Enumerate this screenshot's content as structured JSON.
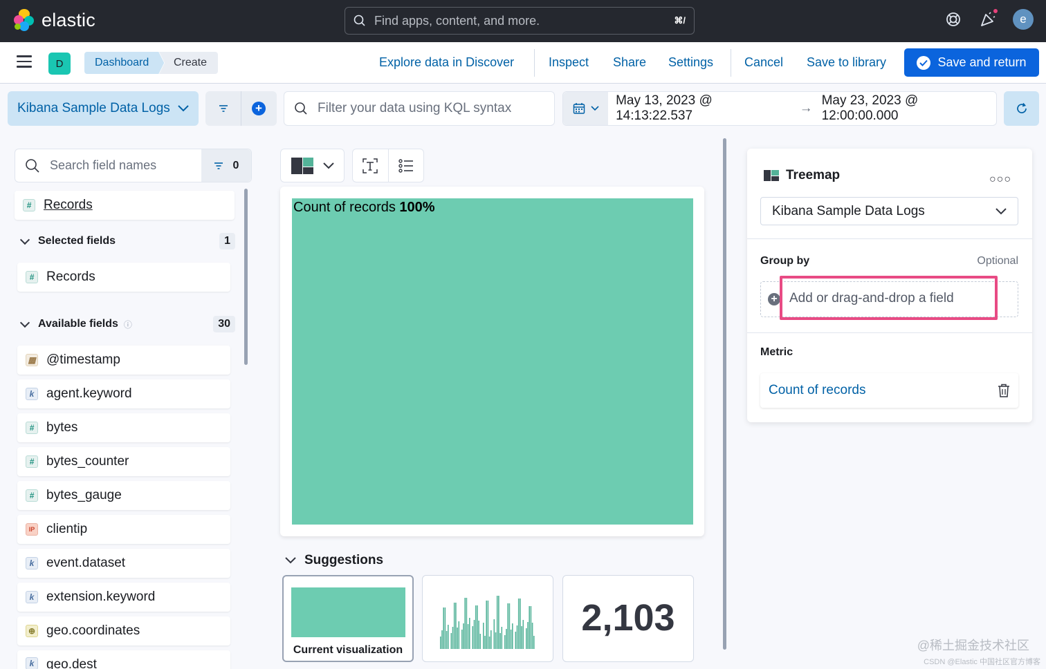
{
  "topbar": {
    "brand": "elastic",
    "search_placeholder": "Find apps, content, and more.",
    "search_shortcut": "⌘/",
    "avatar_initial": "e"
  },
  "header": {
    "space_initial": "D",
    "breadcrumbs": [
      "Dashboard",
      "Create"
    ],
    "links": {
      "explore": "Explore data in Discover",
      "inspect": "Inspect",
      "share": "Share",
      "settings": "Settings",
      "cancel": "Cancel",
      "save_library": "Save to library"
    },
    "save_return": "Save and return"
  },
  "querybar": {
    "data_view": "Kibana Sample Data Logs",
    "kql_placeholder": "Filter your data using KQL syntax",
    "date_start": "May 13, 2023 @ 14:13:22.537",
    "date_arrow": "→",
    "date_end": "May 23, 2023 @ 12:00:00.000"
  },
  "fields": {
    "search_placeholder": "Search field names",
    "filter_count": "0",
    "records_link": "Records",
    "selected": {
      "label": "Selected fields",
      "count": "1",
      "items": [
        "Records"
      ]
    },
    "available": {
      "label": "Available fields",
      "count": "30",
      "items": [
        {
          "name": "@timestamp",
          "type": "date"
        },
        {
          "name": "agent.keyword",
          "type": "keyword"
        },
        {
          "name": "bytes",
          "type": "number"
        },
        {
          "name": "bytes_counter",
          "type": "number"
        },
        {
          "name": "bytes_gauge",
          "type": "number"
        },
        {
          "name": "clientip",
          "type": "ip"
        },
        {
          "name": "event.dataset",
          "type": "keyword"
        },
        {
          "name": "extension.keyword",
          "type": "keyword"
        },
        {
          "name": "geo.coordinates",
          "type": "geo"
        },
        {
          "name": "geo.dest",
          "type": "keyword"
        }
      ]
    }
  },
  "visualization": {
    "treemap_label": "Count of records",
    "treemap_pct": "100%",
    "treemap_color": "#6dccb1"
  },
  "suggestions": {
    "title": "Suggestions",
    "current_label": "Current visualization",
    "metric_value": "2,103"
  },
  "config": {
    "chart_type": "Treemap",
    "data_view": "Kibana Sample Data Logs",
    "group_by_label": "Group by",
    "group_by_optional": "Optional",
    "dropzone_text": "Add or drag-and-drop a field",
    "metric_label": "Metric",
    "metric_value": "Count of records"
  },
  "watermark": "@稀土掘金技术社区",
  "watermark_small": "CSDN @Elastic 中国社区官方博客"
}
